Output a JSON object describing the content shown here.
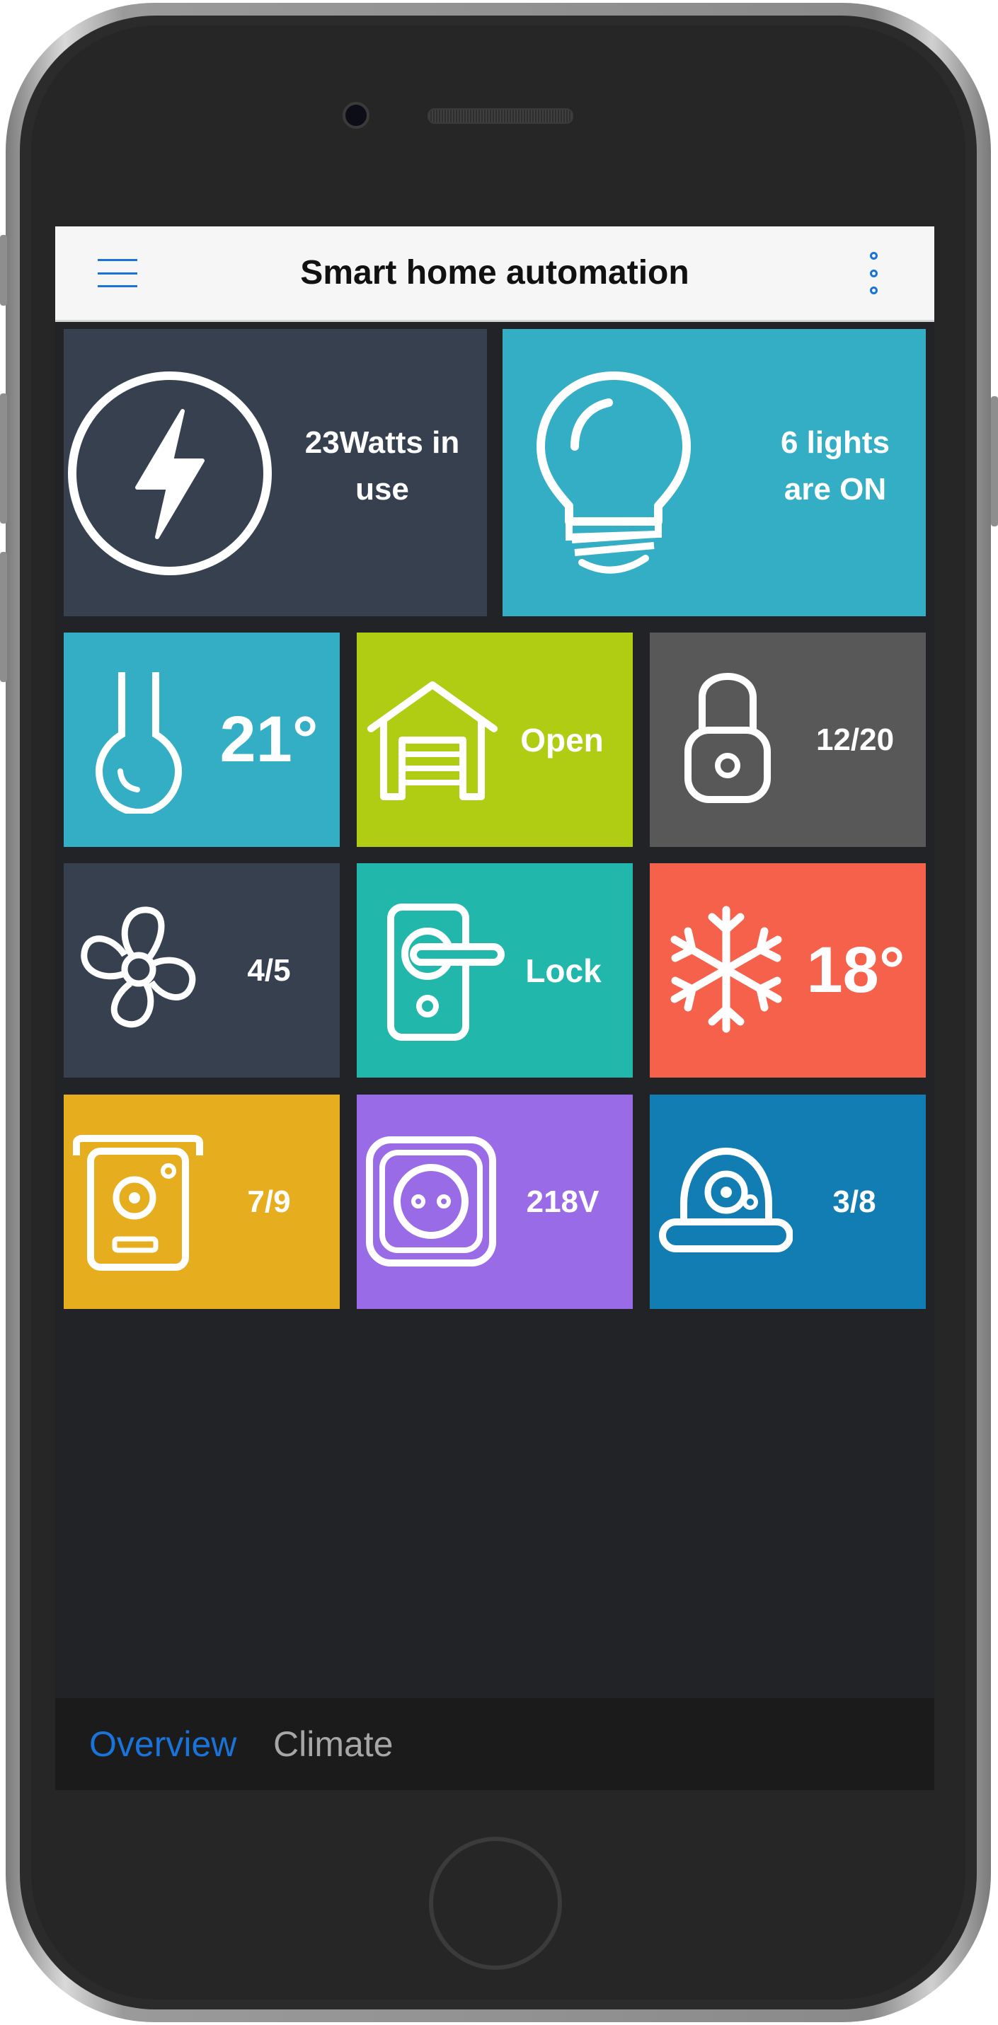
{
  "header": {
    "title": "Smart home automation"
  },
  "tiles": {
    "power": {
      "label_line1": "23Watts in",
      "label_line2": "use",
      "icon": "lightning-icon",
      "color": "#36404f"
    },
    "lights": {
      "label_line1": "6 lights",
      "label_line2": "are ON",
      "icon": "light-bulb-icon",
      "color": "#33aec5"
    },
    "temperature": {
      "label": "21°",
      "icon": "thermometer-icon",
      "color": "#33aec5"
    },
    "garage": {
      "label": "Open",
      "icon": "garage-icon",
      "color": "#b1cd13"
    },
    "padlock": {
      "label": "12/20",
      "icon": "padlock-icon",
      "color": "#585858"
    },
    "fan": {
      "label": "4/5",
      "icon": "fan-icon",
      "color": "#36404f"
    },
    "door_lock": {
      "label": "Lock",
      "icon": "door-handle-icon",
      "color": "#22b7ab"
    },
    "air_conditioner": {
      "label": "18°",
      "icon": "snowflake-icon",
      "color": "#f6614b"
    },
    "intercom": {
      "label": "7/9",
      "icon": "intercom-icon",
      "color": "#e6ad1f"
    },
    "socket": {
      "label": "218V",
      "icon": "power-socket-icon",
      "color": "#9a6be6"
    },
    "camera": {
      "label": "3/8",
      "icon": "security-camera-icon",
      "color": "#127db2"
    }
  },
  "bottom_nav": {
    "tabs": [
      {
        "label": "Overview",
        "active": true,
        "color": "#1a73d9"
      },
      {
        "label": "Climate",
        "active": false,
        "color": "#a7a7a7"
      }
    ]
  }
}
